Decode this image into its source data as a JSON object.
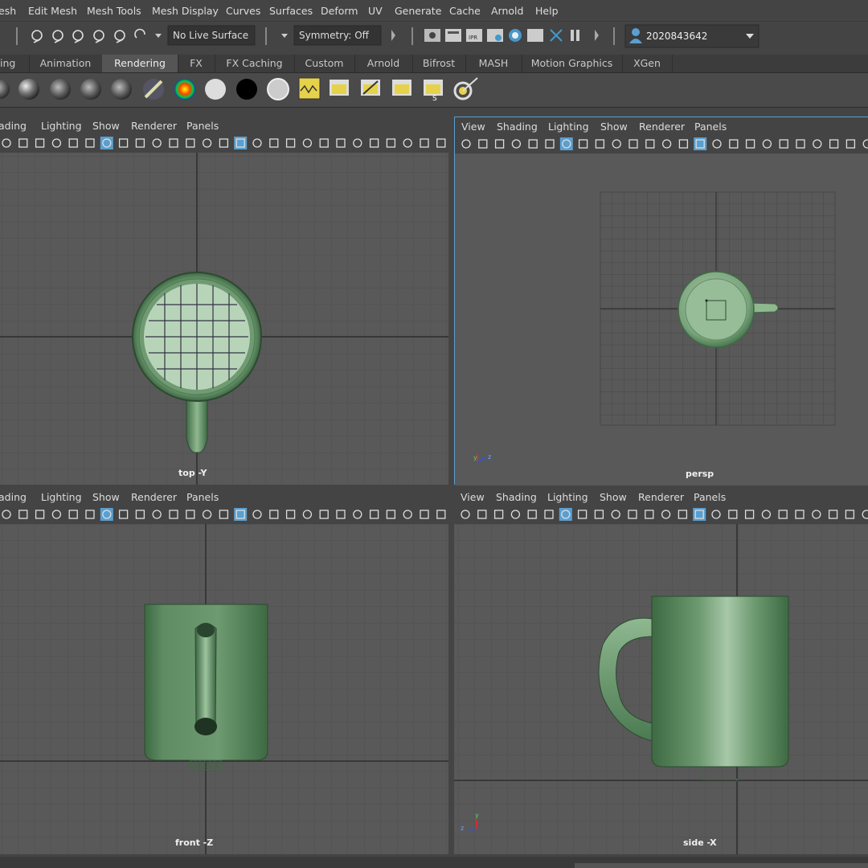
{
  "menubar": [
    "esh",
    "Edit Mesh",
    "Mesh Tools",
    "Mesh Display",
    "Curves",
    "Surfaces",
    "Deform",
    "UV",
    "Generate",
    "Cache",
    "Arnold",
    "Help"
  ],
  "status_line": {
    "live_surface": "No Live Surface",
    "symmetry": "Symmetry: Off",
    "user_id": "2020843642"
  },
  "shelf_tabs": [
    "ing",
    "Animation",
    "Rendering",
    "FX",
    "FX Caching",
    "Custom",
    "Arnold",
    "Bifrost",
    "MASH",
    "Motion Graphics",
    "XGen"
  ],
  "shelf_active": "Rendering",
  "panel_menu": {
    "left": [
      "ading",
      "Lighting",
      "Show",
      "Renderer",
      "Panels"
    ],
    "right": [
      "View",
      "Shading",
      "Lighting",
      "Show",
      "Renderer",
      "Panels"
    ]
  },
  "viewports": {
    "top": {
      "camera": "top -Y"
    },
    "persp": {
      "camera": "persp"
    },
    "front": {
      "camera": "front -Z"
    },
    "side": {
      "camera": "side -X"
    }
  },
  "colors": {
    "mug": "#5f8c63",
    "mug_light": "#8fb890",
    "grid_bg": "#595959",
    "grid_line": "#4e4e4e",
    "axis": "#2e2e2e",
    "highlight": "#5a9fd0"
  },
  "axis_labels": {
    "x": "x",
    "y": "y",
    "z": "z"
  }
}
